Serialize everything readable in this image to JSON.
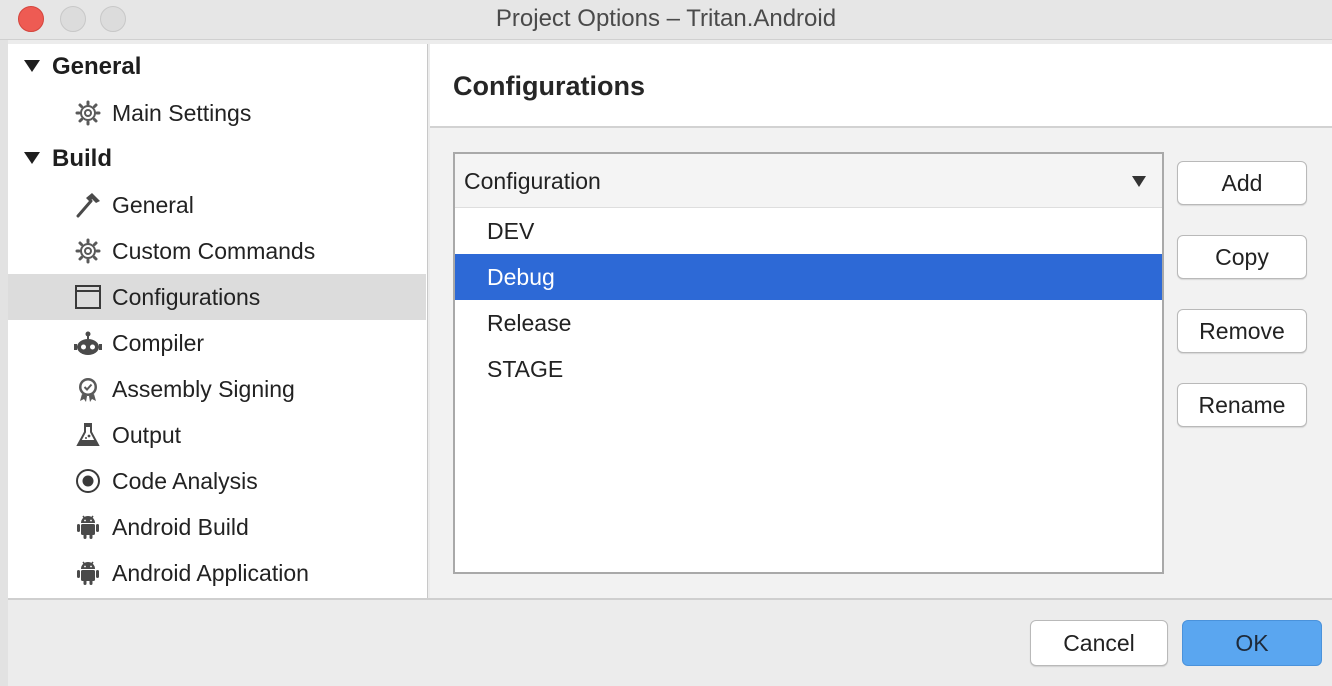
{
  "window": {
    "title": "Project Options – Tritan.Android"
  },
  "sidebar": {
    "sections": [
      {
        "label": "General",
        "items": [
          {
            "label": "Main Settings",
            "icon": "gear-icon"
          }
        ]
      },
      {
        "label": "Build",
        "items": [
          {
            "label": "General",
            "icon": "hammer-icon"
          },
          {
            "label": "Custom Commands",
            "icon": "gear-icon"
          },
          {
            "label": "Configurations",
            "icon": "window-icon",
            "selected": true
          },
          {
            "label": "Compiler",
            "icon": "robot-icon"
          },
          {
            "label": "Assembly Signing",
            "icon": "certificate-badge-icon"
          },
          {
            "label": "Output",
            "icon": "flask-icon"
          },
          {
            "label": "Code Analysis",
            "icon": "target-icon"
          },
          {
            "label": "Android Build",
            "icon": "android-icon"
          },
          {
            "label": "Android Application",
            "icon": "android-icon"
          }
        ]
      }
    ]
  },
  "main": {
    "title": "Configurations",
    "list": {
      "header": "Configuration",
      "items": [
        {
          "label": "DEV"
        },
        {
          "label": "Debug",
          "selected": true
        },
        {
          "label": "Release"
        },
        {
          "label": "STAGE"
        }
      ]
    },
    "buttons": {
      "add": "Add",
      "copy": "Copy",
      "remove": "Remove",
      "rename": "Rename"
    }
  },
  "footer": {
    "cancel": "Cancel",
    "ok": "OK"
  },
  "colors": {
    "selection": "#2d69d6",
    "ok_button": "#5aa6f0",
    "close_button": "#ee5b53"
  }
}
